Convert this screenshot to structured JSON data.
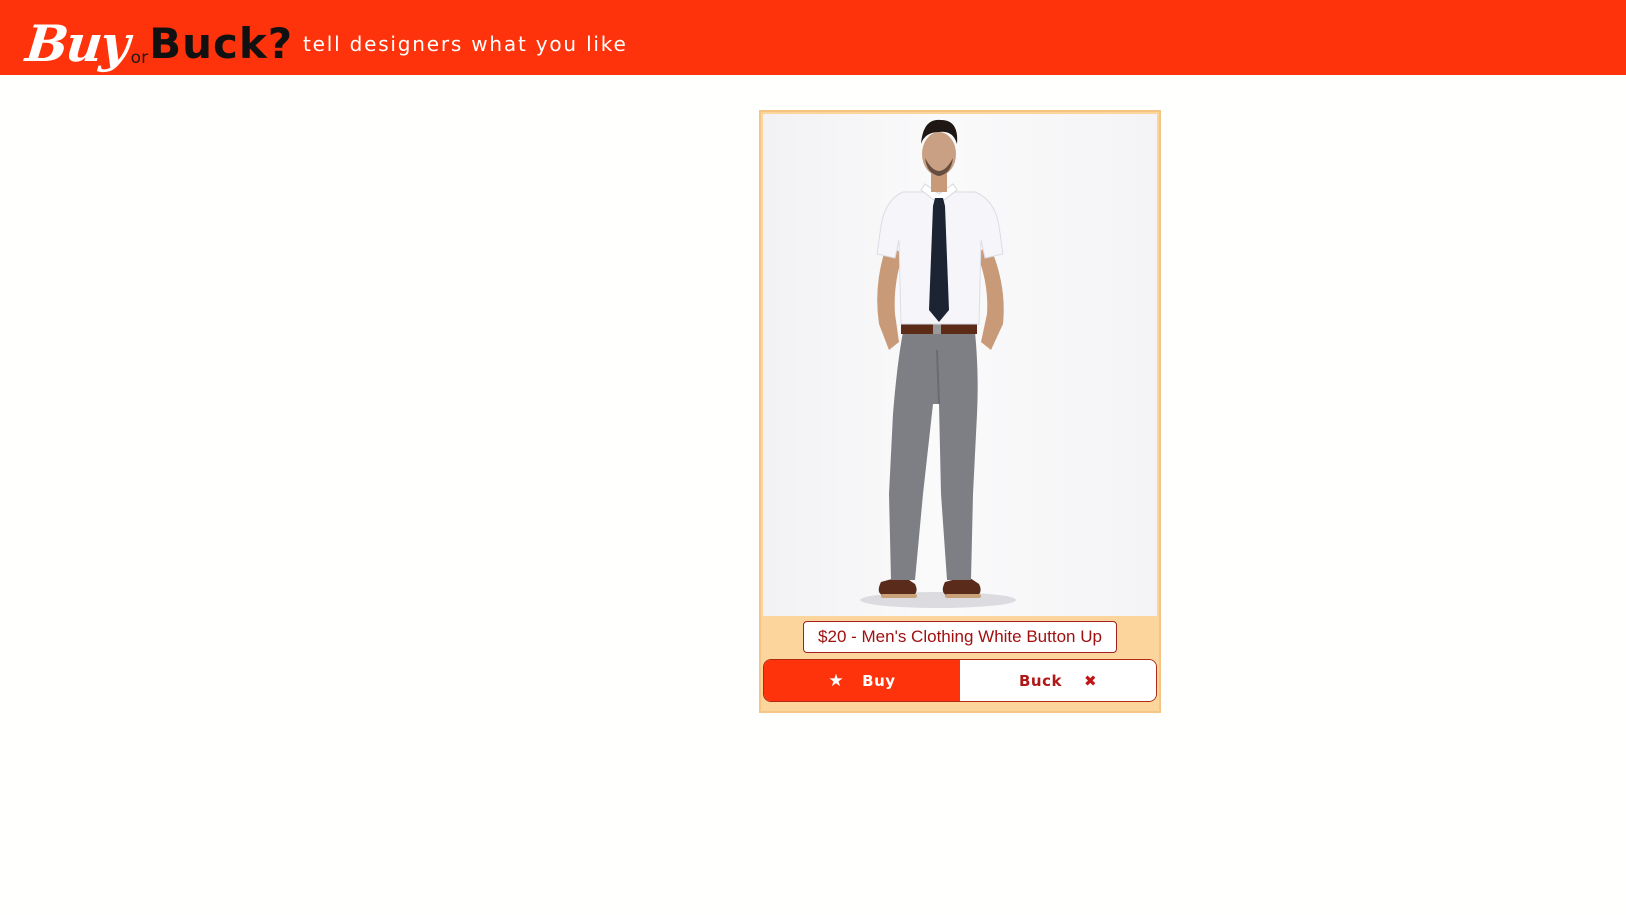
{
  "header": {
    "logo": {
      "buy": "Buy",
      "or": "or",
      "buck": "Buck?"
    },
    "tagline": "tell designers what you like"
  },
  "product": {
    "image_alt": "Man wearing white short-sleeve button up shirt, dark tie, grey trousers and brown shoes",
    "title": "$20 - Men's Clothing White Button Up"
  },
  "actions": {
    "buy_label": "Buy",
    "buy_icon": "star-icon",
    "buck_label": "Buck",
    "buck_icon": "close-icon"
  },
  "colors": {
    "brand_red": "#ff330b",
    "card_bg": "#fcd59d",
    "text_red": "#a01010"
  }
}
